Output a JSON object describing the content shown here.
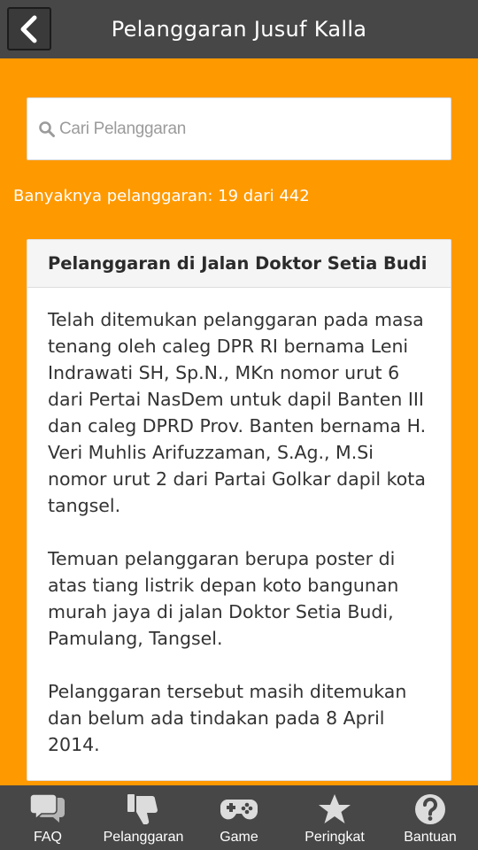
{
  "header": {
    "title": "Pelanggaran Jusuf Kalla",
    "back_icon": "chevron-left-icon"
  },
  "search": {
    "placeholder": "Cari Pelanggaran",
    "value": ""
  },
  "summary": {
    "count_text": "Banyaknya pelanggaran: 19 dari 442"
  },
  "card": {
    "title": "Pelanggaran di Jalan Doktor Setia Budi",
    "paragraphs": [
      "Telah ditemukan pelanggaran pada masa tenang oleh caleg DPR RI bernama Leni Indrawati SH, Sp.N., MKn nomor urut 6 dari Pertai NasDem untuk dapil Banten III dan caleg DPRD Prov. Banten bernama H. Veri Muhlis Arifuzzaman, S.Ag., M.Si nomor urut 2 dari Partai Golkar dapil kota tangsel.",
      "Temuan pelanggaran berupa poster di atas tiang listrik depan koto bangunan murah jaya di jalan Doktor Setia Budi, Pamulang, Tangsel.",
      "Pelanggaran tersebut masih ditemukan dan belum ada tindakan pada 8 April 2014."
    ]
  },
  "tabs": [
    {
      "label": "FAQ",
      "icon": "chat-bubbles-icon"
    },
    {
      "label": "Pelanggaran",
      "icon": "thumbs-down-icon"
    },
    {
      "label": "Game",
      "icon": "gamepad-icon"
    },
    {
      "label": "Peringkat",
      "icon": "star-icon"
    },
    {
      "label": "Bantuan",
      "icon": "question-icon"
    }
  ],
  "colors": {
    "background": "#ff9900",
    "bar": "#474747",
    "card_header": "#f5f5f5"
  }
}
